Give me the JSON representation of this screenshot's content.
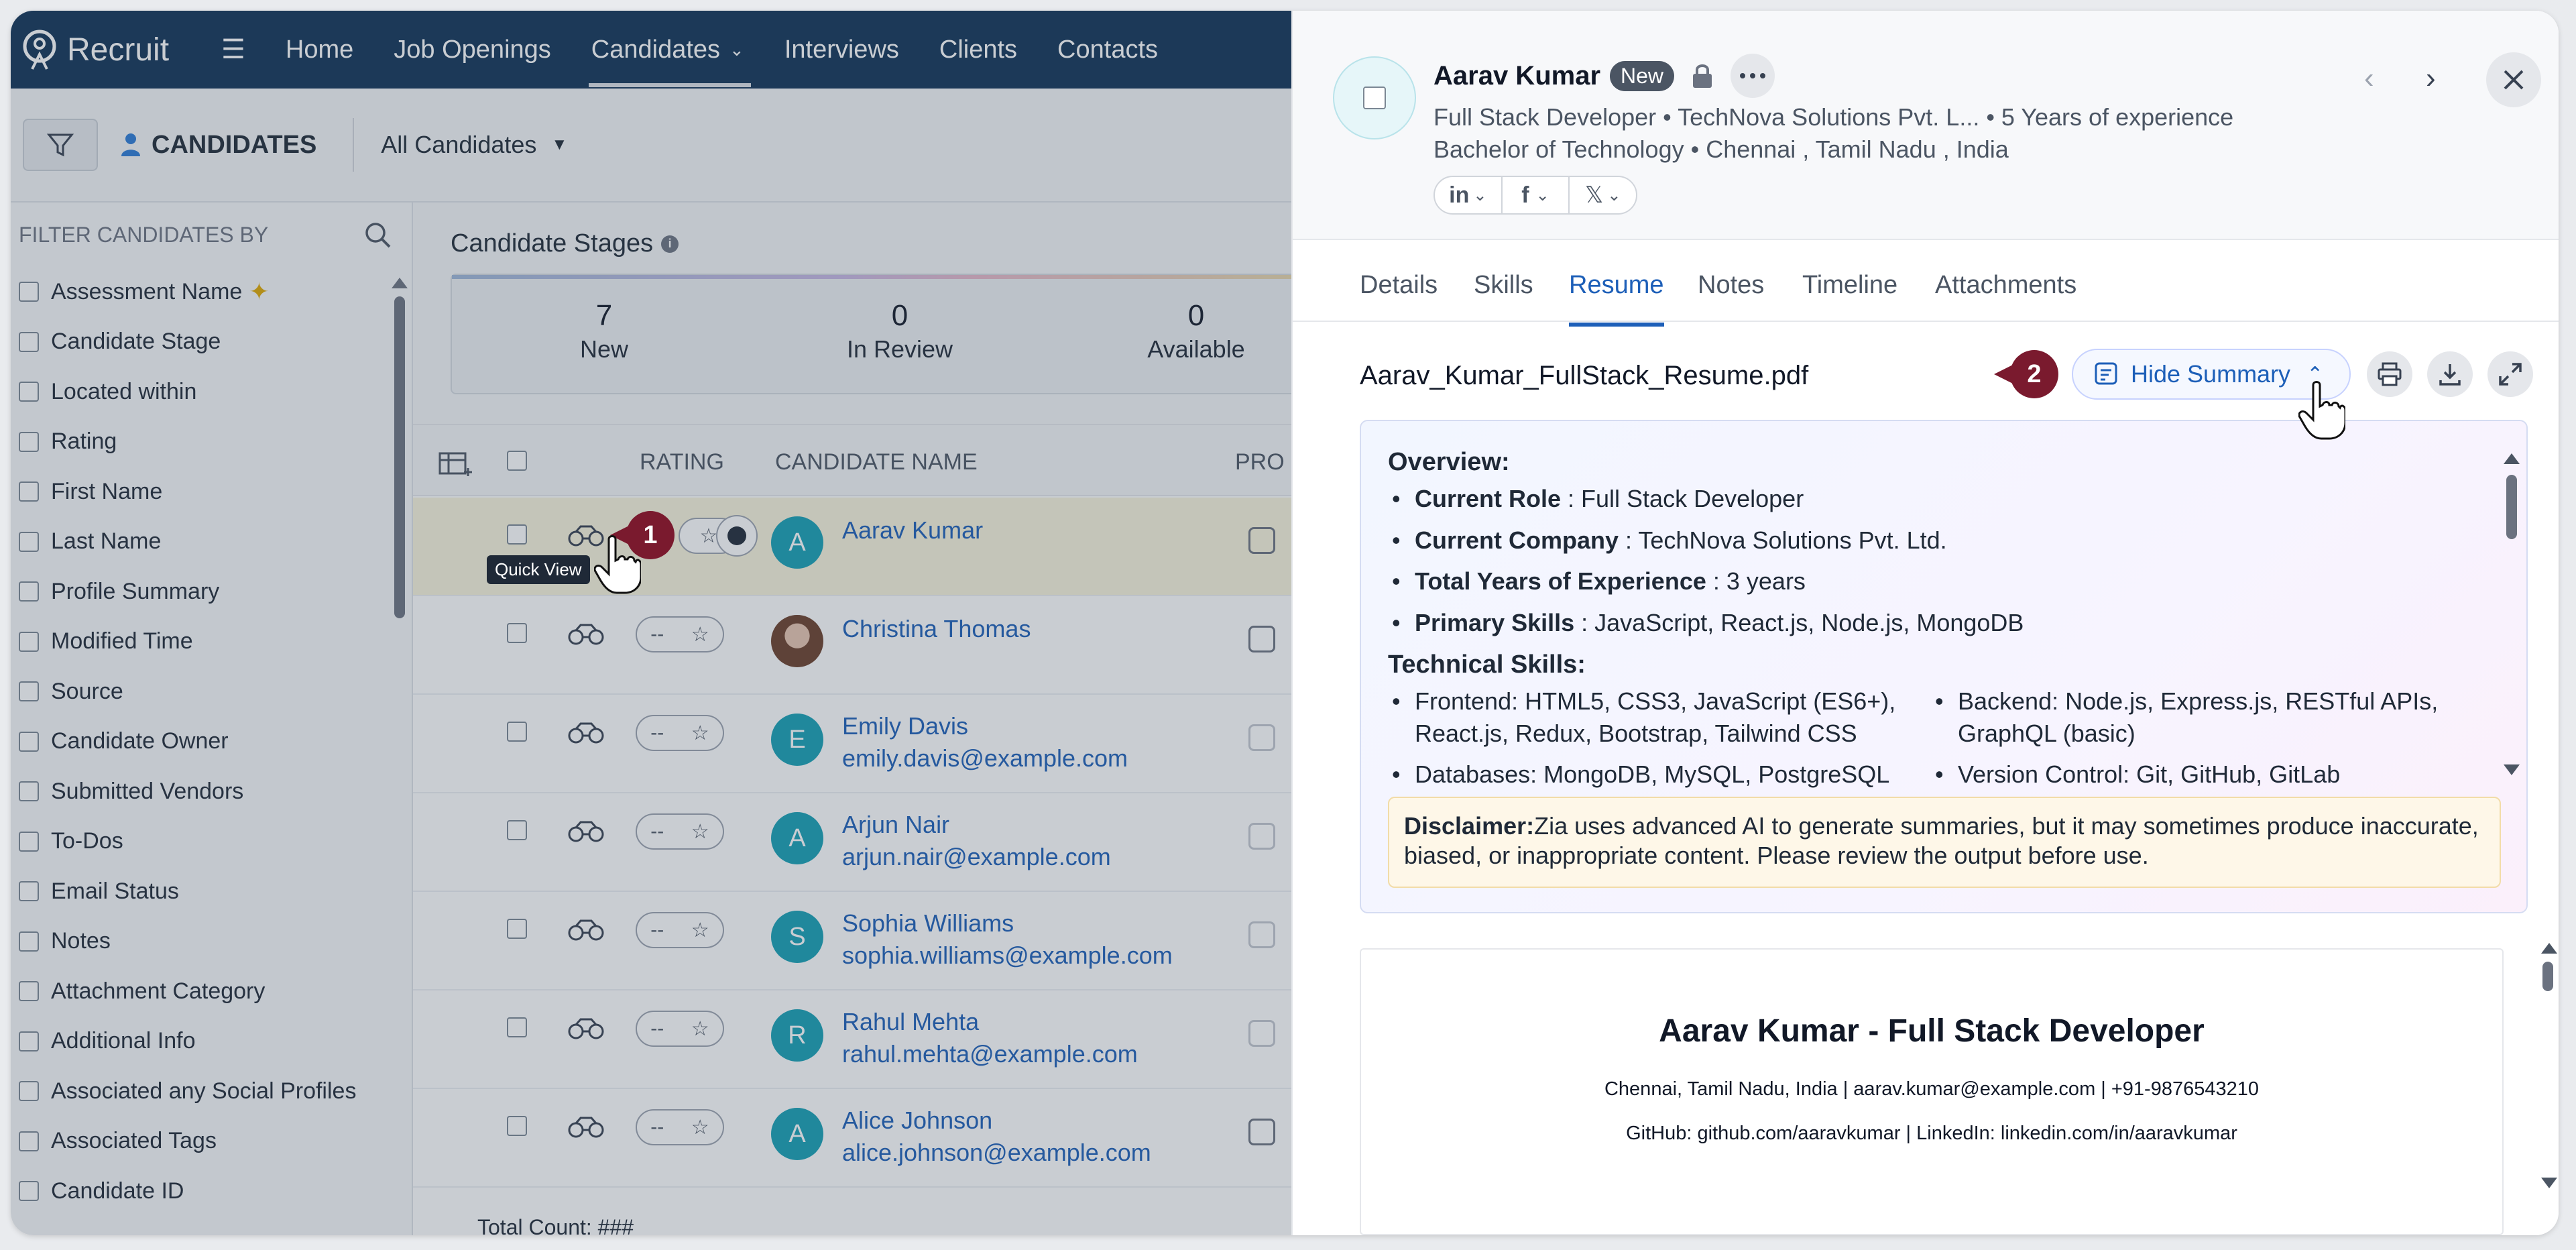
{
  "app": {
    "name": "Recruit"
  },
  "nav": {
    "items": [
      "Home",
      "Job Openings",
      "Candidates",
      "Interviews",
      "Clients",
      "Contacts"
    ],
    "active": "Candidates"
  },
  "subbar": {
    "module_title": "CANDIDATES",
    "view_select": "All Candidates"
  },
  "filters": {
    "title": "FILTER CANDIDATES BY",
    "items": [
      "Assessment Name",
      "Candidate Stage",
      "Located within",
      "Rating",
      "First Name",
      "Last Name",
      "Profile Summary",
      "Modified Time",
      "Source",
      "Candidate Owner",
      "Submitted Vendors",
      "To-Dos",
      "Email Status",
      "Notes",
      "Attachment Category",
      "Additional Info",
      "Associated any Social Profiles",
      "Associated Tags",
      "Candidate ID"
    ]
  },
  "stages": {
    "title": "Candidate Stages",
    "cells": [
      {
        "count": "7",
        "label": "New"
      },
      {
        "count": "0",
        "label": "In Review"
      },
      {
        "count": "0",
        "label": "Available"
      }
    ]
  },
  "table": {
    "headers": {
      "rating": "RATING",
      "name": "CANDIDATE NAME",
      "pro": "PRO"
    },
    "rows": [
      {
        "initial": "A",
        "name": "Aarav Kumar",
        "email": "",
        "rating": "",
        "photo": false,
        "selected": true
      },
      {
        "initial": "",
        "name": "Christina Thomas",
        "email": "",
        "rating": "--",
        "photo": true,
        "selected": false
      },
      {
        "initial": "E",
        "name": "Emily Davis",
        "email": "emily.davis@example.com",
        "rating": "--",
        "photo": false,
        "selected": false
      },
      {
        "initial": "A",
        "name": "Arjun Nair",
        "email": "arjun.nair@example.com",
        "rating": "--",
        "photo": false,
        "selected": false
      },
      {
        "initial": "S",
        "name": "Sophia Williams",
        "email": "sophia.williams@example.com",
        "rating": "--",
        "photo": false,
        "selected": false
      },
      {
        "initial": "R",
        "name": "Rahul Mehta",
        "email": "rahul.mehta@example.com",
        "rating": "--",
        "photo": false,
        "selected": false
      },
      {
        "initial": "A",
        "name": "Alice Johnson",
        "email": "alice.johnson@example.com",
        "rating": "--",
        "photo": false,
        "selected": false
      }
    ],
    "total_count": "Total Count: ###",
    "tooltip": "Quick View"
  },
  "steps": {
    "one": "1",
    "two": "2"
  },
  "panel": {
    "name": "Aarav Kumar",
    "badge": "New",
    "line1": "Full Stack Developer • TechNova Solutions Pvt. L... • 5 Years of experience",
    "line2": "Bachelor of Technology • Chennai , Tamil Nadu , India",
    "socials": [
      "in",
      "f",
      "𝕏"
    ],
    "tabs": [
      "Details",
      "Skills",
      "Resume",
      "Notes",
      "Timeline",
      "Attachments"
    ],
    "active_tab": "Resume",
    "file_name": "Aarav_Kumar_FullStack_Resume.pdf",
    "hide_summary": "Hide Summary"
  },
  "summary": {
    "overview_heading": "Overview:",
    "overview": [
      {
        "k": "Current Role",
        "v": " : Full Stack Developer"
      },
      {
        "k": "Current Company",
        "v": " : TechNova Solutions Pvt. Ltd."
      },
      {
        "k": "Total Years of Experience",
        "v": " : 3 years"
      },
      {
        "k": "Primary Skills",
        "v": " : JavaScript, React.js, Node.js, MongoDB"
      }
    ],
    "tech_heading": "Technical Skills:",
    "tech_left": [
      "Frontend: HTML5, CSS3, JavaScript (ES6+), React.js, Redux, Bootstrap, Tailwind CSS",
      "Databases: MongoDB, MySQL, PostgreSQL"
    ],
    "tech_right": [
      "Backend: Node.js, Express.js, RESTful APIs, GraphQL (basic)",
      "Version Control: Git, GitHub, GitLab"
    ],
    "disclaimer_label": "Disclaimer:",
    "disclaimer_text": "Zia uses advanced AI to generate summaries, but it may sometimes produce inaccurate, biased, or inappropriate content. Please review the output before use."
  },
  "resume": {
    "title": "Aarav Kumar - Full Stack Developer",
    "line1": "Chennai, Tamil Nadu, India | aarav.kumar@example.com | +91-9876543210",
    "line2": "GitHub: github.com/aaravkumar | LinkedIn: linkedin.com/in/aaravkumar"
  },
  "colors": {
    "nav_bg": "#103357",
    "link": "#1d5fb8",
    "step_badge": "#7a1a2e",
    "avatar": "#15a0b5"
  }
}
